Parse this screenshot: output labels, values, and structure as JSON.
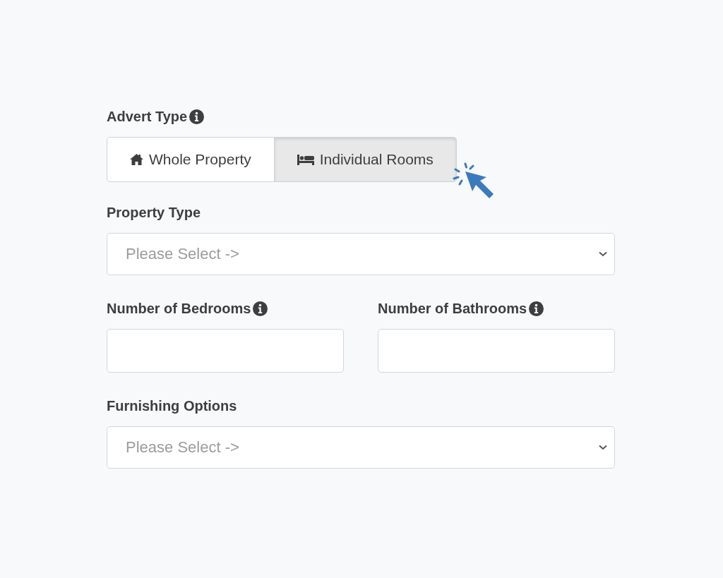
{
  "advert_type": {
    "label": "Advert Type",
    "info_icon": true,
    "options": [
      {
        "label": "Whole Property",
        "kind": "house",
        "selected": false
      },
      {
        "label": "Individual Rooms",
        "kind": "bed",
        "selected": true
      }
    ]
  },
  "property_type": {
    "label": "Property Type",
    "info_icon": false,
    "placeholder": "Please Select ->"
  },
  "bedrooms": {
    "label": "Number of Bedrooms",
    "info_icon": true
  },
  "bathrooms": {
    "label": "Number of Bathrooms",
    "info_icon": true
  },
  "furnishing": {
    "label": "Furnishing Options",
    "info_icon": false,
    "placeholder": "Please Select ->"
  }
}
